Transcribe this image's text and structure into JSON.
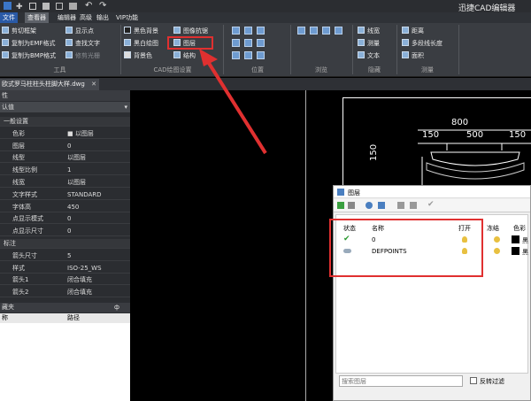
{
  "app_title": "迅捷CAD编辑器",
  "menu": [
    "文件",
    "查看器",
    "编辑器",
    "高级",
    "输出",
    "VIP功能"
  ],
  "ribbon": {
    "tools": [
      "剪切框架",
      "复制为EMF格式",
      "复制为BMP格式",
      "显示点",
      "查找文字",
      "修剪光栅"
    ],
    "draw_settings": [
      "黑色背景",
      "黑白绘图",
      "背景色",
      "图像抗锯",
      "图层",
      "结构"
    ],
    "hide": [
      "线宽",
      "测量",
      "文本"
    ],
    "measure": [
      "距离",
      "多段线长度",
      "面积"
    ],
    "groups": [
      "工具",
      "CAD绘图设置",
      "位置",
      "浏览",
      "隐藏",
      "测量"
    ]
  },
  "doc_tab": "欧式罗马柱柱头柱脚大样.dwg",
  "left_panel": {
    "header": "性",
    "dropdown": "认值",
    "rows": [
      {
        "k": "一般设置",
        "v": "",
        "section": true
      },
      {
        "k": "色彩",
        "v": "■ 以图层"
      },
      {
        "k": "图层",
        "v": "0"
      },
      {
        "k": "线型",
        "v": "以图层"
      },
      {
        "k": "线型比例",
        "v": "1"
      },
      {
        "k": "线宽",
        "v": "以图层"
      },
      {
        "k": "文字样式",
        "v": "STANDARD"
      },
      {
        "k": "字体高",
        "v": "450"
      },
      {
        "k": "点显示模式",
        "v": "0"
      },
      {
        "k": "点显示尺寸",
        "v": "0"
      },
      {
        "k": "标注",
        "v": "",
        "section": true
      },
      {
        "k": "箭头尺寸",
        "v": "5"
      },
      {
        "k": "样式",
        "v": "ISO-25_WS"
      },
      {
        "k": "箭头1",
        "v": "闭合填充"
      },
      {
        "k": "箭头2",
        "v": "闭合填充"
      }
    ],
    "bookmark_header": "藏夹",
    "bookmark_pin": "ф",
    "bookmark_cols": [
      "称",
      "路径"
    ]
  },
  "drawing": {
    "dims": [
      "800",
      "150",
      "500",
      "150",
      "150"
    ]
  },
  "layer_dialog": {
    "title": "图层",
    "headers": [
      "状态",
      "名称",
      "打开",
      "冻结",
      "色彩"
    ],
    "layers": [
      {
        "name": "0",
        "color": "黑"
      },
      {
        "name": "DEFPOINTS",
        "color": "黑"
      }
    ],
    "search_placeholder": "搜索图层",
    "filter_label": "反转过滤"
  },
  "colors": {
    "accent": "#e03030"
  }
}
